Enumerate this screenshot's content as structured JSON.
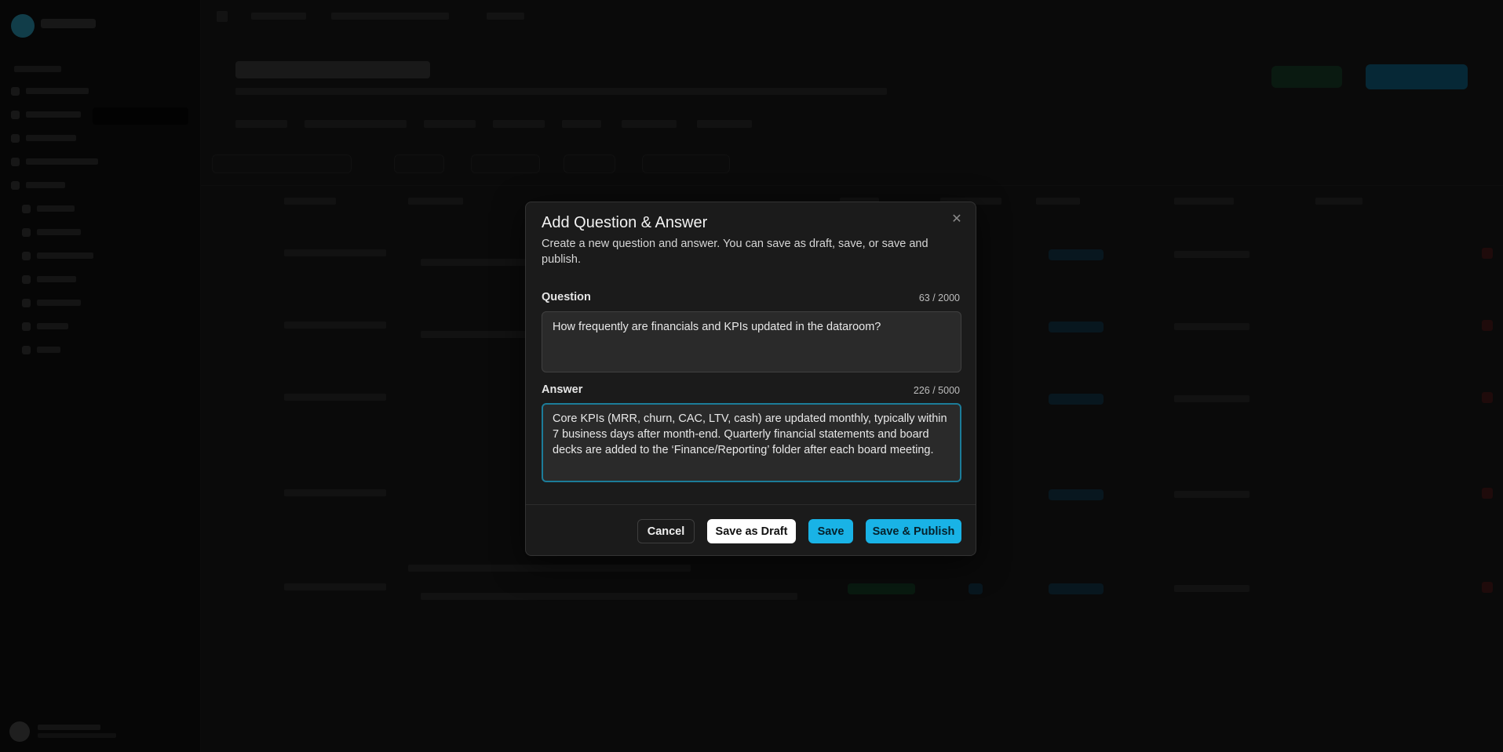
{
  "dialog": {
    "title": "Add Question & Answer",
    "description": "Create a new question and answer. You can save as draft, save, or save and publish.",
    "question": {
      "label": "Question",
      "count": "63 / 2000",
      "value": "How frequently are financials and KPIs updated in the dataroom?"
    },
    "answer": {
      "label": "Answer",
      "count": "226 / 5000",
      "value": "Core KPIs (MRR, churn, CAC, LTV, cash) are updated monthly, typically within 7 business days after month-end. Quarterly financial statements and board decks are added to the ‘Finance/Reporting’ folder after each board meeting."
    },
    "buttons": {
      "cancel": "Cancel",
      "save_draft": "Save as Draft",
      "save": "Save",
      "save_publish": "Save & Publish"
    },
    "close_icon": "close-icon"
  },
  "colors": {
    "accent": "#19b3e6",
    "focus_ring": "#1c7c99",
    "dialog_bg": "#1b1b1b"
  }
}
